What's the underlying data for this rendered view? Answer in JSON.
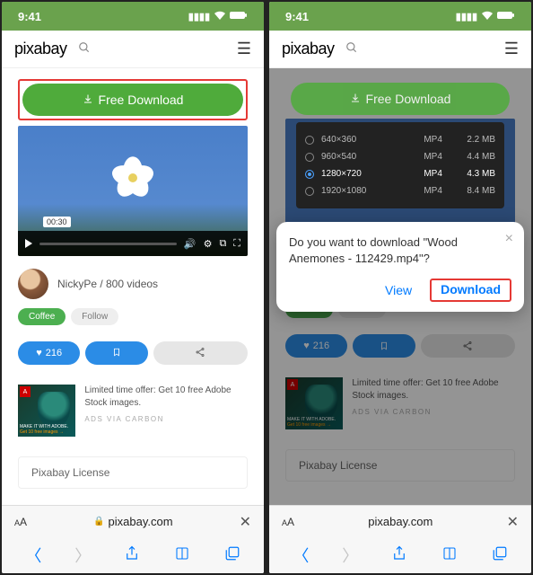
{
  "statusbar": {
    "time": "9:41"
  },
  "header": {
    "logo": "pixabay"
  },
  "download_button": {
    "label": "Free Download"
  },
  "video": {
    "timestamp": "00:30"
  },
  "uploader": {
    "name": "NickyPe",
    "videos_text": "800 videos",
    "combined": "NickyPe / 800 videos"
  },
  "tags": {
    "coffee": "Coffee",
    "follow": "Follow"
  },
  "actions": {
    "likes": "216"
  },
  "ad": {
    "badge": "A",
    "overlay_line1": "MAKE IT WITH ADOBE.",
    "overlay_line2": "Get 10 free images →",
    "text": "Limited time offer: Get 10 free Adobe Stock images.",
    "sub": "ADS VIA CARBON"
  },
  "license": {
    "title": "Pixabay License"
  },
  "safari": {
    "domain": "pixabay.com",
    "aa": "AA"
  },
  "resolutions": [
    {
      "dim": "640×360",
      "fmt": "MP4",
      "size": "2.2 MB",
      "selected": false
    },
    {
      "dim": "960×540",
      "fmt": "MP4",
      "size": "4.4 MB",
      "selected": false
    },
    {
      "dim": "1280×720",
      "fmt": "MP4",
      "size": "4.3 MB",
      "selected": true
    },
    {
      "dim": "1920×1080",
      "fmt": "MP4",
      "size": "8.4 MB",
      "selected": false
    }
  ],
  "dialog": {
    "text": "Do you want to download \"Wood Anemones - 112429.mp4\"?",
    "view": "View",
    "download": "Download"
  }
}
